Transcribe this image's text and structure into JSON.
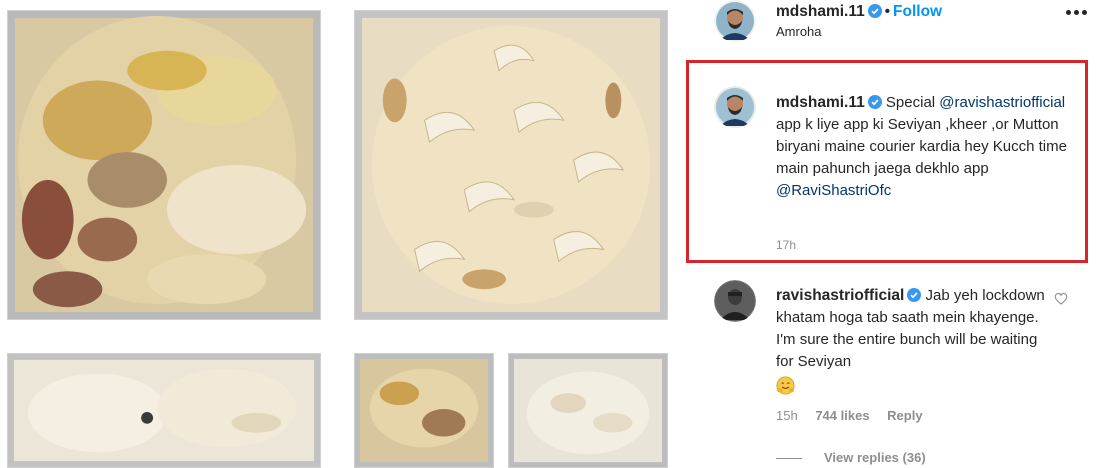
{
  "post": {
    "username": "mdshami.11",
    "separator": "•",
    "follow_label": "Follow",
    "location": "Amroha",
    "more_icon": "more-options-icon"
  },
  "caption": {
    "username": "mdshami.11",
    "word_special": "Special",
    "mention_1": "@ravishastriofficial",
    "body": "app k liye app ki Seviyan ,kheer ,or Mutton biryani maine courier kardia hey Kucch time main pahunch jaega dekhlo app",
    "mention_2": "@RaviShastriOfc",
    "time": "17h",
    "highlight_color": "#d6252c"
  },
  "comment": {
    "username": "ravishastriofficial",
    "text": "Jab yeh lockdown khatam hoga tab saath mein khayenge. I'm sure the entire bunch will be waiting for Seviyan",
    "emoji": "hugging-face-emoji",
    "time": "15h",
    "likes": "744 likes",
    "reply_label": "Reply",
    "view_replies": "View replies (36)"
  },
  "colors": {
    "link_blue": "#0095f6",
    "mention_blue": "#00376b",
    "verified_blue": "#3897f0",
    "muted": "#8e8e8e"
  }
}
